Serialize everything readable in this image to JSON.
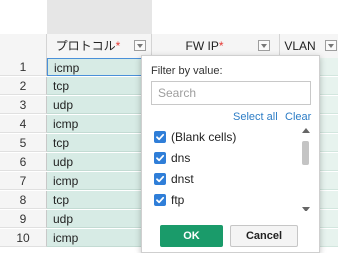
{
  "columns": [
    {
      "label": "プロトコル",
      "required_mark": "*"
    },
    {
      "label": "FW IP",
      "required_mark": "*"
    },
    {
      "label": "VLAN",
      "required_mark": ""
    }
  ],
  "rows": [
    {
      "num": "1",
      "protocol": "icmp"
    },
    {
      "num": "2",
      "protocol": "tcp"
    },
    {
      "num": "3",
      "protocol": "udp"
    },
    {
      "num": "4",
      "protocol": "icmp"
    },
    {
      "num": "5",
      "protocol": "tcp"
    },
    {
      "num": "6",
      "protocol": "udp"
    },
    {
      "num": "7",
      "protocol": "icmp"
    },
    {
      "num": "8",
      "protocol": "tcp"
    },
    {
      "num": "9",
      "protocol": "udp"
    },
    {
      "num": "10",
      "protocol": "icmp"
    }
  ],
  "filter": {
    "title": "Filter by value:",
    "search_placeholder": "Search",
    "search_value": "",
    "select_all": "Select all",
    "clear": "Clear",
    "options": [
      {
        "label": "(Blank cells)",
        "checked": true
      },
      {
        "label": "dns",
        "checked": true
      },
      {
        "label": "dnst",
        "checked": true
      },
      {
        "label": "ftp",
        "checked": true
      }
    ],
    "ok_label": "OK",
    "cancel_label": "Cancel"
  },
  "colors": {
    "accent": "#1a9b6a",
    "checkbox": "#2f7ed8",
    "link": "#2d7dc6",
    "column_fill": "#d7ebe5"
  }
}
